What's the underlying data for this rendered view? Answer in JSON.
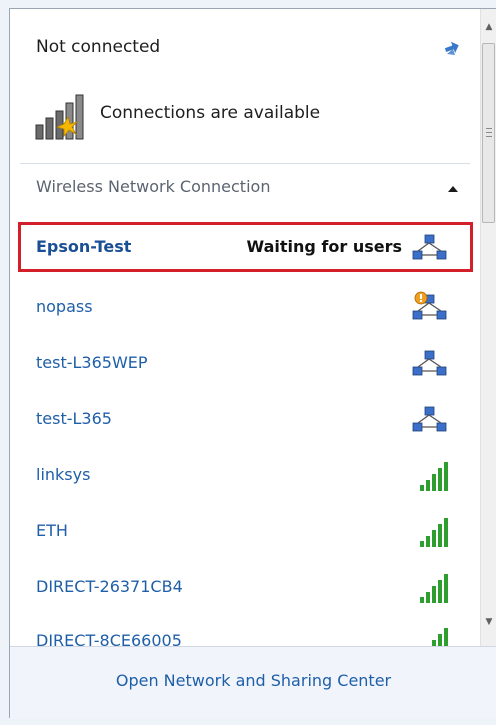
{
  "header": {
    "status": "Not connected",
    "connections_text": "Connections are available"
  },
  "section": {
    "title": "Wireless Network Connection"
  },
  "networks": [
    {
      "name": "Epson-Test",
      "status": "Waiting for users",
      "icon": "adhoc-network-icon",
      "selected": true
    },
    {
      "name": "nopass",
      "status": "",
      "icon": "adhoc-network-warning-icon"
    },
    {
      "name": "test-L365WEP",
      "status": "",
      "icon": "adhoc-network-icon"
    },
    {
      "name": "test-L365",
      "status": "",
      "icon": "adhoc-network-icon"
    },
    {
      "name": "linksys",
      "status": "",
      "icon": "signal-bars-icon"
    },
    {
      "name": "ETH",
      "status": "",
      "icon": "signal-bars-icon"
    },
    {
      "name": "DIRECT-26371CB4",
      "status": "",
      "icon": "signal-bars-icon"
    },
    {
      "name": "DIRECT-8CE66005",
      "status": "",
      "icon": "signal-bars-icon"
    }
  ],
  "footer": {
    "link": "Open Network and Sharing Center"
  },
  "colors": {
    "link": "#1f5fa8",
    "highlight": "#d31f2a",
    "signal": "#2e9e2e"
  }
}
